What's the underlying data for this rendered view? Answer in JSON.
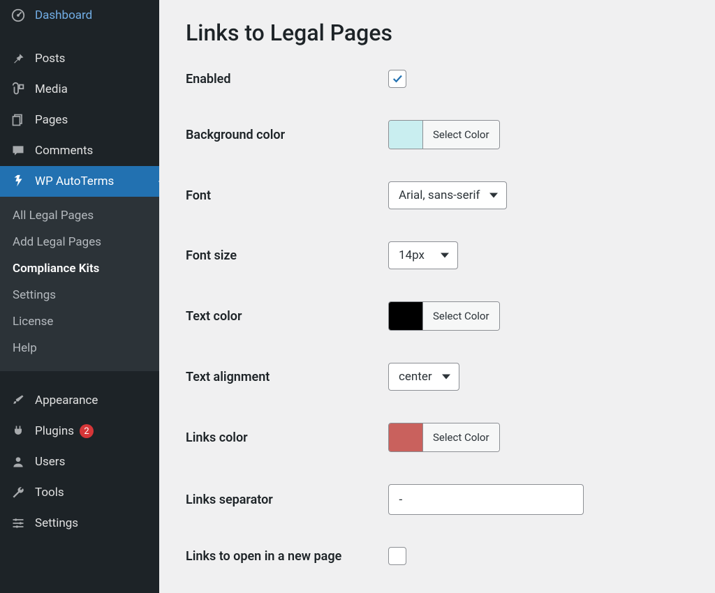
{
  "sidebar": {
    "items": [
      {
        "label": "Dashboard",
        "icon": "dashboard"
      },
      {
        "label": "Posts",
        "icon": "pin"
      },
      {
        "label": "Media",
        "icon": "media"
      },
      {
        "label": "Pages",
        "icon": "pages"
      },
      {
        "label": "Comments",
        "icon": "comment"
      },
      {
        "label": "WP AutoTerms",
        "icon": "shield",
        "active": true
      },
      {
        "label": "Appearance",
        "icon": "brush"
      },
      {
        "label": "Plugins",
        "icon": "plug",
        "badge": "2"
      },
      {
        "label": "Users",
        "icon": "user"
      },
      {
        "label": "Tools",
        "icon": "wrench"
      },
      {
        "label": "Settings",
        "icon": "sliders"
      }
    ],
    "submenu": [
      {
        "label": "All Legal Pages"
      },
      {
        "label": "Add Legal Pages"
      },
      {
        "label": "Compliance Kits",
        "current": true
      },
      {
        "label": "Settings"
      },
      {
        "label": "License"
      },
      {
        "label": "Help"
      }
    ]
  },
  "page": {
    "title": "Links to Legal Pages",
    "fields": {
      "enabled": {
        "label": "Enabled",
        "checked": true
      },
      "background_color": {
        "label": "Background color",
        "swatch": "#c9eef0",
        "button": "Select Color"
      },
      "font": {
        "label": "Font",
        "value": "Arial, sans-serif"
      },
      "font_size": {
        "label": "Font size",
        "value": "14px"
      },
      "text_color": {
        "label": "Text color",
        "swatch": "#000000",
        "button": "Select Color"
      },
      "text_alignment": {
        "label": "Text alignment",
        "value": "center"
      },
      "links_color": {
        "label": "Links color",
        "swatch": "#c9615d",
        "button": "Select Color"
      },
      "links_separator": {
        "label": "Links separator",
        "value": "-"
      },
      "links_new_page": {
        "label": "Links to open in a new page",
        "checked": false
      }
    }
  }
}
